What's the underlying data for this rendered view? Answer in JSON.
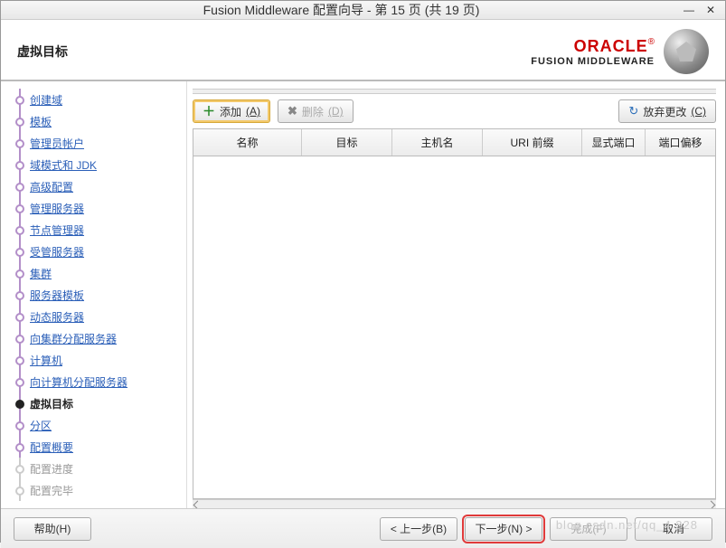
{
  "window": {
    "title": "Fusion Middleware 配置向导 - 第 15 页 (共 19 页)"
  },
  "header": {
    "page_title": "虚拟目标",
    "brand_oracle": "ORACLE",
    "brand_suffix": "®",
    "brand_fm": "FUSION MIDDLEWARE"
  },
  "sidebar": {
    "items": [
      {
        "label": "创建域",
        "state": "done"
      },
      {
        "label": "模板",
        "state": "done"
      },
      {
        "label": "管理员帐户",
        "state": "done"
      },
      {
        "label": "域模式和 JDK",
        "state": "done"
      },
      {
        "label": "高级配置",
        "state": "done"
      },
      {
        "label": "管理服务器",
        "state": "done"
      },
      {
        "label": "节点管理器",
        "state": "done"
      },
      {
        "label": "受管服务器",
        "state": "done"
      },
      {
        "label": "集群",
        "state": "done"
      },
      {
        "label": "服务器模板",
        "state": "done"
      },
      {
        "label": "动态服务器",
        "state": "done"
      },
      {
        "label": "向集群分配服务器",
        "state": "done"
      },
      {
        "label": "计算机",
        "state": "done"
      },
      {
        "label": "向计算机分配服务器",
        "state": "done"
      },
      {
        "label": "虚拟目标",
        "state": "current"
      },
      {
        "label": "分区",
        "state": "done"
      },
      {
        "label": "配置概要",
        "state": "done"
      },
      {
        "label": "配置进度",
        "state": "future"
      },
      {
        "label": "配置完毕",
        "state": "future"
      }
    ]
  },
  "toolbar": {
    "add_label": "添加",
    "add_key": "(A)",
    "delete_label": "删除",
    "delete_key": "(D)",
    "discard_label": "放弃更改",
    "discard_key": "(C)"
  },
  "table": {
    "columns": {
      "name": "名称",
      "target": "目标",
      "host": "主机名",
      "uri": "URI 前缀",
      "port": "显式端口",
      "offset": "端口偏移"
    }
  },
  "footer": {
    "help": "帮助(H)",
    "back": "< 上一步(B)",
    "next": "下一步(N) >",
    "finish": "完成(F)",
    "cancel": "取消"
  },
  "watermark": "blog.csdn.net/qq_4   328"
}
